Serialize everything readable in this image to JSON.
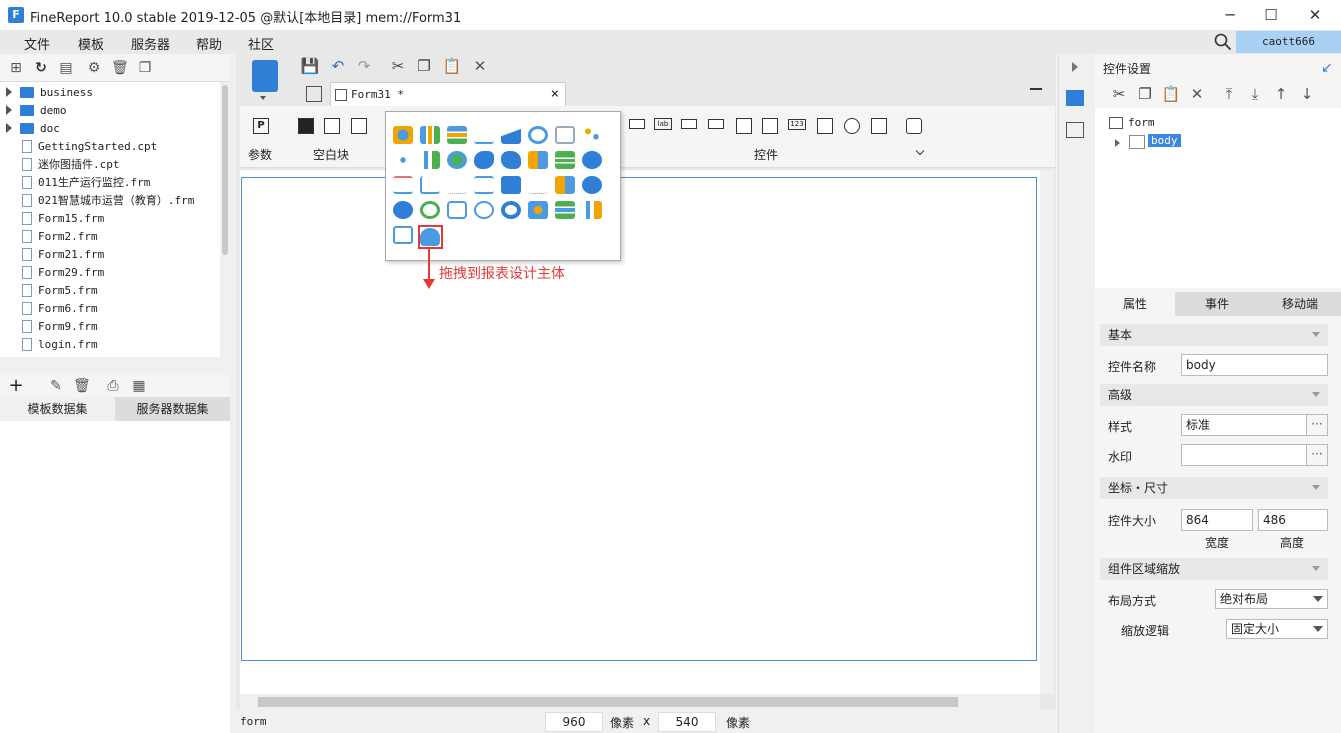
{
  "window": {
    "title": "FineReport 10.0 stable 2019-12-05 @默认[本地目录]    mem://Form31",
    "logo_letter": "F",
    "minimize": "─",
    "maximize": "☐",
    "close": "✕"
  },
  "menu": {
    "items": [
      "文件",
      "模板",
      "服务器",
      "帮助",
      "社区"
    ],
    "user": "caott666"
  },
  "tree": {
    "items": [
      {
        "label": "business",
        "type": "folder"
      },
      {
        "label": "demo",
        "type": "folder"
      },
      {
        "label": "doc",
        "type": "folder"
      },
      {
        "label": "GettingStarted.cpt",
        "type": "file"
      },
      {
        "label": "迷你图插件.cpt",
        "type": "file"
      },
      {
        "label": "011生产运行监控.frm",
        "type": "file"
      },
      {
        "label": "021智慧城市运营（教育）.frm",
        "type": "file"
      },
      {
        "label": "Form15.frm",
        "type": "file"
      },
      {
        "label": "Form2.frm",
        "type": "file"
      },
      {
        "label": "Form21.frm",
        "type": "file"
      },
      {
        "label": "Form29.frm",
        "type": "file"
      },
      {
        "label": "Form5.frm",
        "type": "file"
      },
      {
        "label": "Form6.frm",
        "type": "file"
      },
      {
        "label": "Form9.frm",
        "type": "file"
      },
      {
        "label": "login.frm",
        "type": "file"
      }
    ]
  },
  "dataset_tabs": [
    "模板数据集",
    "服务器数据集"
  ],
  "doc_tab": {
    "label": "Form31 *",
    "close": "×"
  },
  "ribbon": {
    "param_label": "参数",
    "param_icon_text": "P",
    "blank_label": "空白块",
    "control_label": "控件",
    "lab_text": "lab",
    "num_text": "123"
  },
  "drag_hint": "拖拽到报表设计主体",
  "status": {
    "form": "form",
    "width": "960",
    "unit1": "像素",
    "x": "x",
    "height": "540",
    "unit2": "像素"
  },
  "right_panel": {
    "title": "控件设置",
    "tree_root": "form",
    "tree_child": "body",
    "tabs": [
      "属性",
      "事件",
      "移动端"
    ],
    "sections": {
      "basic": "基本",
      "advanced": "高级",
      "coord": "坐标・尺寸",
      "zoom": "组件区域缩放"
    },
    "name_label": "控件名称",
    "name_value": "body",
    "style_label": "样式",
    "style_value": "标准",
    "watermark_label": "水印",
    "watermark_value": "",
    "size_label": "控件大小",
    "width_value": "864",
    "height_value": "486",
    "width_caption": "宽度",
    "height_caption": "高度",
    "layout_label": "布局方式",
    "layout_value": "绝对布局",
    "zoom_label": "缩放逻辑",
    "zoom_value": "固定大小",
    "dots": "···"
  },
  "colors": {
    "accent": "#2f7fd6",
    "highlight": "#e53935",
    "user_bg": "#a9d1f3"
  }
}
